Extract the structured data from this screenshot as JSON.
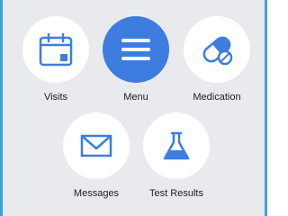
{
  "nav": {
    "items": [
      {
        "label": "Visits",
        "icon": "calendar-icon"
      },
      {
        "label": "Menu",
        "icon": "menu-icon",
        "active": true
      },
      {
        "label": "Medication",
        "icon": "pill-capsule-icon"
      },
      {
        "label": "Messages",
        "icon": "envelope-icon"
      },
      {
        "label": "Test Results",
        "icon": "flask-icon"
      }
    ]
  },
  "colors": {
    "accent": "#3d7de0",
    "border": "#3aa3de",
    "background": "#e9eaee",
    "tile": "#ffffff"
  }
}
